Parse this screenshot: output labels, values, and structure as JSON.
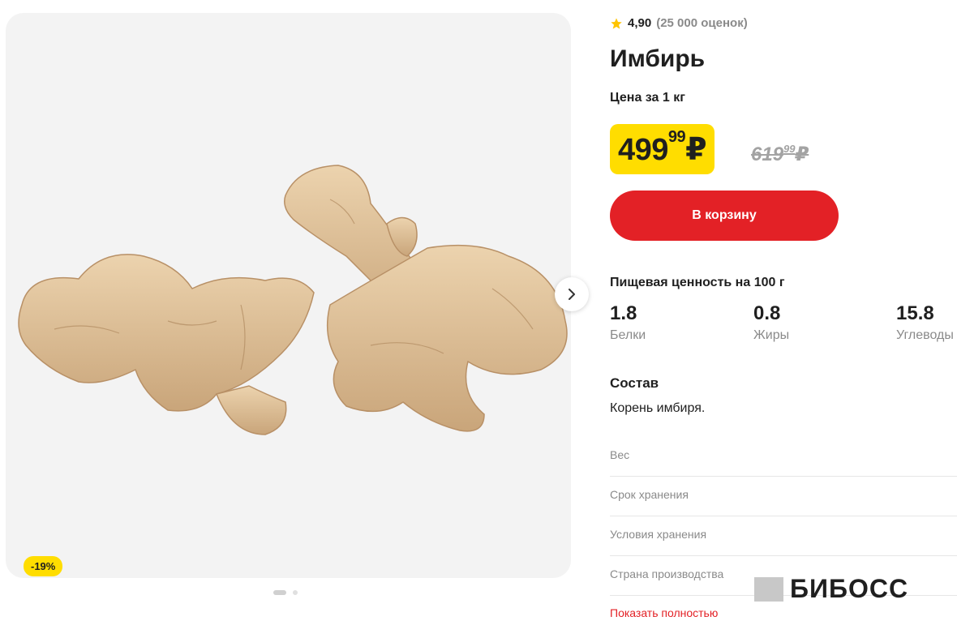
{
  "product": {
    "rating": "4,90",
    "rating_count": "(25 000 оценок)",
    "title": "Имбирь",
    "price_unit": "Цена за 1 кг",
    "price_integer": "499",
    "price_fraction": "99",
    "currency": "₽",
    "old_price_integer": "619",
    "old_price_fraction": "99",
    "discount": "-19%",
    "add_to_cart": "В корзину"
  },
  "nutrition": {
    "title": "Пищевая ценность на 100 г",
    "items": [
      {
        "value": "1.8",
        "label": "Белки"
      },
      {
        "value": "0.8",
        "label": "Жиры"
      },
      {
        "value": "15.8",
        "label": "Углеводы"
      }
    ]
  },
  "composition": {
    "title": "Состав",
    "text": "Корень имбиря."
  },
  "specs": [
    "Вес",
    "Срок хранения",
    "Условия хранения",
    "Страна производства"
  ],
  "show_more": "Показать полностью",
  "watermark": "БИБОСС",
  "gallery": {
    "slides": 2,
    "active": 1
  },
  "colors": {
    "accent_yellow": "#ffdd00",
    "accent_red": "#e32126",
    "muted": "#8a8a8a"
  },
  "icons": {
    "rating": "star-icon",
    "next": "chevron-right-icon"
  }
}
